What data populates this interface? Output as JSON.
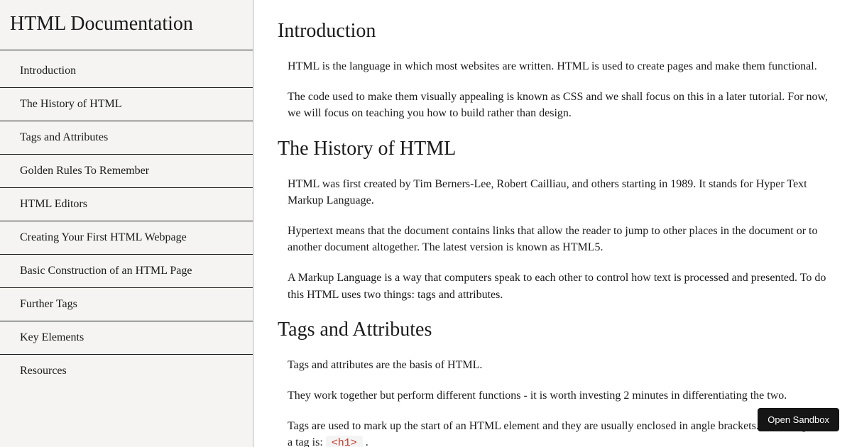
{
  "sidebar": {
    "title": "HTML Documentation",
    "items": [
      {
        "label": "Introduction"
      },
      {
        "label": "The History of HTML"
      },
      {
        "label": "Tags and Attributes"
      },
      {
        "label": "Golden Rules To Remember"
      },
      {
        "label": "HTML Editors"
      },
      {
        "label": "Creating Your First HTML Webpage"
      },
      {
        "label": "Basic Construction of an HTML Page"
      },
      {
        "label": "Further Tags"
      },
      {
        "label": "Key Elements"
      },
      {
        "label": "Resources"
      }
    ]
  },
  "sections": {
    "intro": {
      "heading": "Introduction",
      "p1": "HTML is the language in which most websites are written. HTML is used to create pages and make them functional.",
      "p2": "The code used to make them visually appealing is known as CSS and we shall focus on this in a later tutorial. For now, we will focus on teaching you how to build rather than design."
    },
    "history": {
      "heading": "The History of HTML",
      "p1": "HTML was first created by Tim Berners-Lee, Robert Cailliau, and others starting in 1989. It stands for Hyper Text Markup Language.",
      "p2": "Hypertext means that the document contains links that allow the reader to jump to other places in the document or to another document altogether. The latest version is known as HTML5.",
      "p3": "A Markup Language is a way that computers speak to each other to control how text is processed and presented. To do this HTML uses two things: tags and attributes."
    },
    "tags": {
      "heading": "Tags and Attributes",
      "p1": "Tags and attributes are the basis of HTML.",
      "p2": "They work together but perform different functions - it is worth investing 2 minutes in differentiating the two.",
      "p3a": "Tags are used to mark up the start of an HTML element and they are usually enclosed in angle brackets. An example of a tag is: ",
      "code": "<h1>",
      "p3b": " ."
    }
  },
  "sandbox_button": "Open Sandbox"
}
